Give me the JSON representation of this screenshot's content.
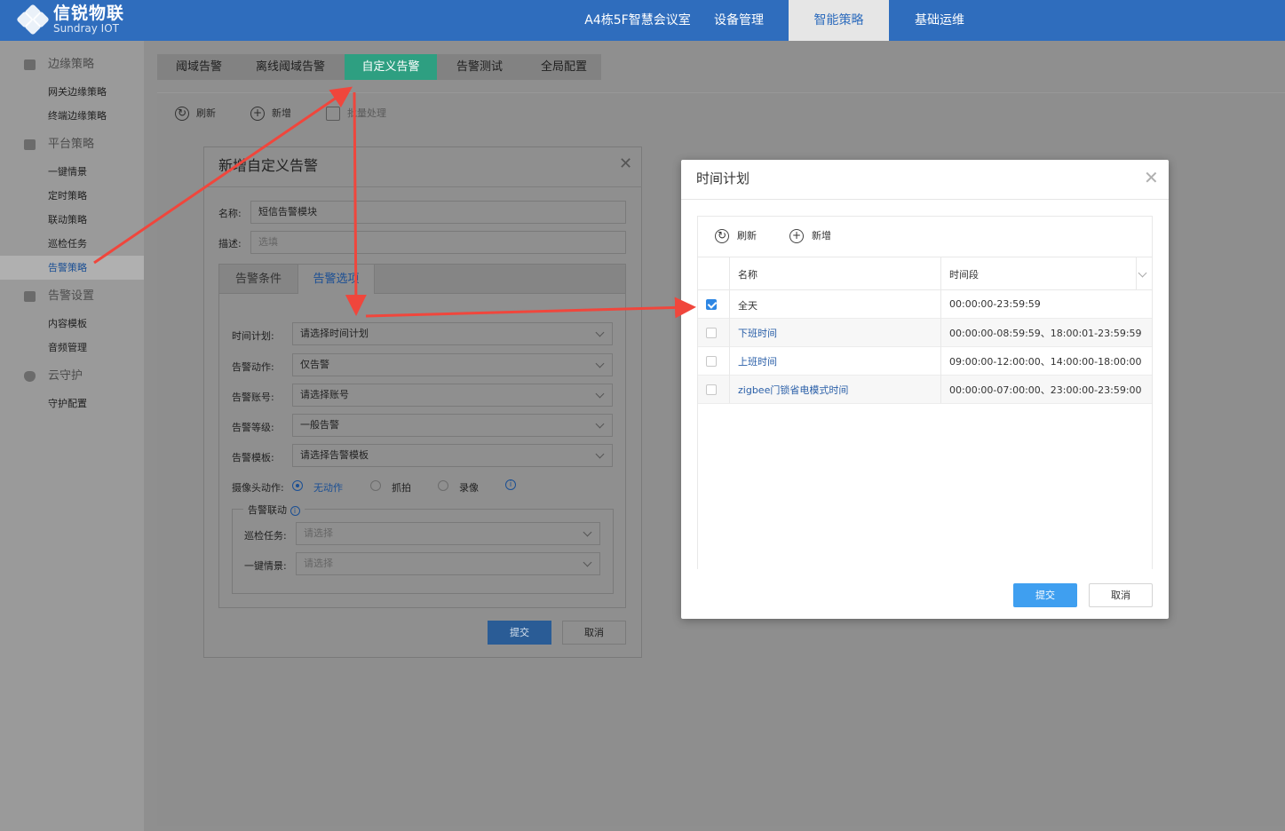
{
  "brand": {
    "title": "信锐物联",
    "subtitle": "Sundray IOT"
  },
  "nav": [
    "A4栋5F智慧会议室",
    "设备管理",
    "智能策略",
    "基础运维"
  ],
  "sidebar": {
    "groups": [
      {
        "label": "边缘策略",
        "items": [
          "网关边缘策略",
          "终端边缘策略"
        ]
      },
      {
        "label": "平台策略",
        "items": [
          "一键情景",
          "定时策略",
          "联动策略",
          "巡检任务",
          "告警策略"
        ]
      },
      {
        "label": "告警设置",
        "items": [
          "内容模板",
          "音频管理"
        ]
      },
      {
        "label": "云守护",
        "items": [
          "守护配置"
        ]
      }
    ]
  },
  "tabs": [
    "阈域告警",
    "离线阈域告警",
    "自定义告警",
    "告警测试",
    "全局配置"
  ],
  "toolbar": {
    "refresh": "刷新",
    "add": "新增",
    "batch": "批量处理"
  },
  "dialog_add": {
    "title": "新增自定义告警",
    "name_label": "名称:",
    "name_value": "短信告警模块",
    "desc_label": "描述:",
    "desc_placeholder": "选填",
    "subtabs": [
      "告警条件",
      "告警选项"
    ],
    "fields": [
      {
        "label": "时间计划:",
        "value": "请选择时间计划"
      },
      {
        "label": "告警动作:",
        "value": "仅告警"
      },
      {
        "label": "告警账号:",
        "value": "请选择账号"
      },
      {
        "label": "告警等级:",
        "value": "一般告警"
      },
      {
        "label": "告警模板:",
        "value": "请选择告警模板"
      }
    ],
    "camera_label": "摄像头动作:",
    "camera_options": [
      "无动作",
      "抓拍",
      "录像"
    ],
    "linkage_legend": "告警联动",
    "linkage_fields": [
      {
        "label": "巡检任务:",
        "placeholder": "请选择"
      },
      {
        "label": "一键情景:",
        "placeholder": "请选择"
      }
    ],
    "submit": "提交",
    "cancel": "取消"
  },
  "dialog_time": {
    "title": "时间计划",
    "toolbar": {
      "refresh": "刷新",
      "add": "新增"
    },
    "columns": [
      "名称",
      "时间段"
    ],
    "rows": [
      {
        "name": "全天",
        "time": "00:00:00-23:59:59",
        "checked": true
      },
      {
        "name": "下班时间",
        "time": "00:00:00-08:59:59、18:00:01-23:59:59",
        "checked": false
      },
      {
        "name": "上班时间",
        "time": "09:00:00-12:00:00、14:00:00-18:00:00",
        "checked": false
      },
      {
        "name": "zigbee门锁省电模式时间",
        "time": "00:00:00-07:00:00、23:00:00-23:59:00",
        "checked": false
      }
    ],
    "submit": "提交",
    "cancel": "取消"
  },
  "colors": {
    "primary": "#2f6dbd",
    "tab_active": "#2e9f81",
    "arrow": "#f0463c",
    "submit": "#3f9ff0"
  }
}
